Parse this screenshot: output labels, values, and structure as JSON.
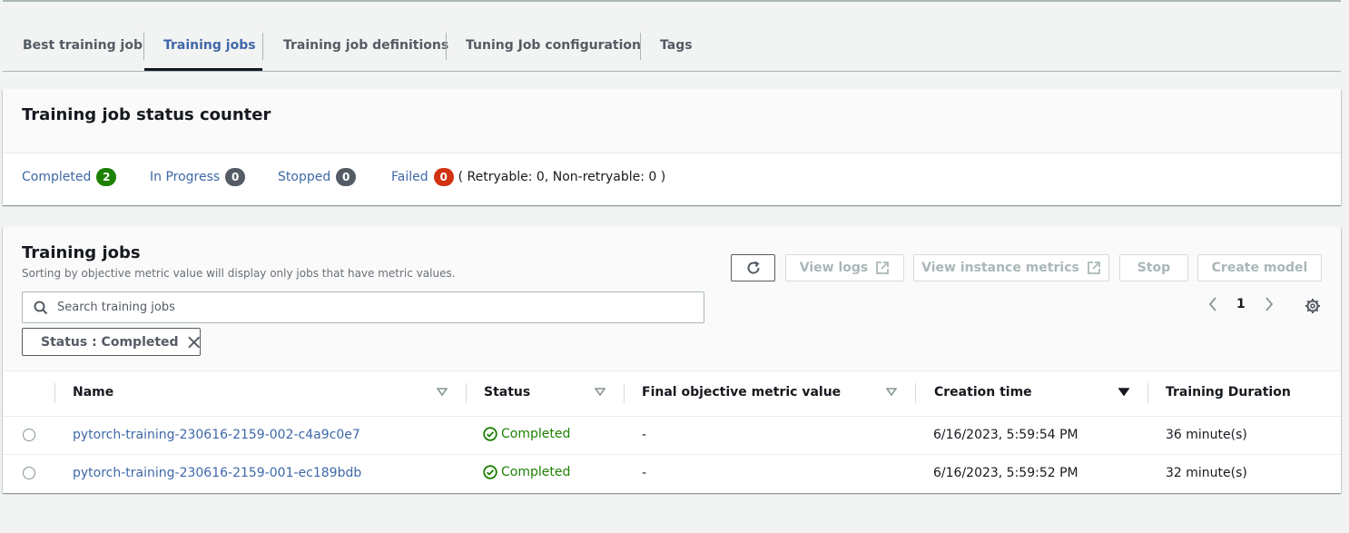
{
  "tabs": [
    {
      "label": "Best training job"
    },
    {
      "label": "Training jobs"
    },
    {
      "label": "Training job definitions"
    },
    {
      "label": "Tuning Job configuration"
    },
    {
      "label": "Tags"
    }
  ],
  "status_counter": {
    "title": "Training job status counter",
    "items": [
      {
        "label": "Completed",
        "count": "2",
        "color": "#1d8102"
      },
      {
        "label": "In Progress",
        "count": "0",
        "color": "#545b64"
      },
      {
        "label": "Stopped",
        "count": "0",
        "color": "#545b64"
      },
      {
        "label": "Failed",
        "count": "0",
        "color": "#d13212"
      }
    ],
    "retry_note": "( Retryable: 0, Non-retryable: 0 )"
  },
  "training_jobs": {
    "title": "Training jobs",
    "subtitle": "Sorting by objective metric value will display only jobs that have metric values.",
    "buttons": {
      "refresh_icon": "refresh-icon",
      "view_logs": "View logs",
      "view_instance_metrics": "View instance metrics",
      "stop": "Stop",
      "create_model": "Create model"
    },
    "search_placeholder": "Search training jobs",
    "filter_chip": "Status : Completed",
    "page": "1",
    "columns": [
      "Name",
      "Status",
      "Final objective metric value",
      "Creation time",
      "Training Duration"
    ],
    "rows": [
      {
        "name": "pytorch-training-230616-2159-002-c4a9c0e7",
        "status": "Completed",
        "metric": "-",
        "created": "6/16/2023, 5:59:54 PM",
        "duration": "36 minute(s)"
      },
      {
        "name": "pytorch-training-230616-2159-001-ec189bdb",
        "status": "Completed",
        "metric": "-",
        "created": "6/16/2023, 5:59:52 PM",
        "duration": "32 minute(s)"
      }
    ]
  },
  "colors": {
    "link": "#3f68a8",
    "success": "#1d8102",
    "error": "#d13212",
    "neutral": "#545b64"
  }
}
